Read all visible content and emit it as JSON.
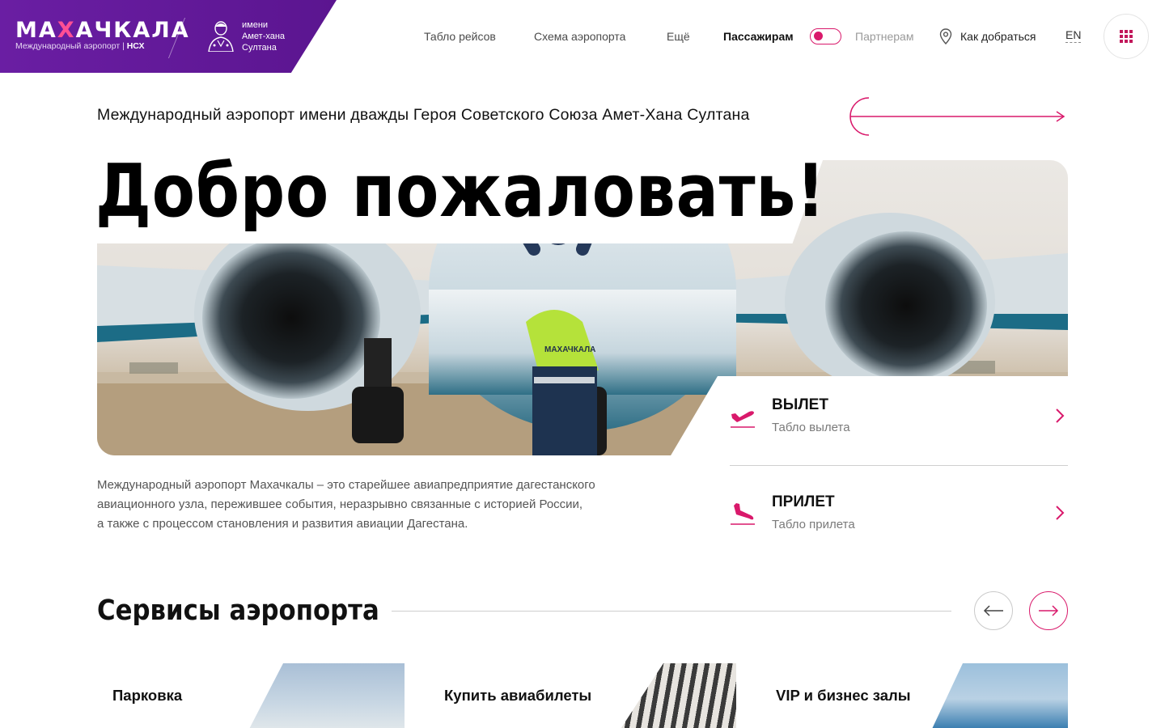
{
  "header": {
    "logo_title": "МАХАЧКАЛА",
    "logo_subtitle": "Международный аэропорт",
    "logo_brand": "НСХ",
    "honor_line1": "имени",
    "honor_line2": "Амет-хана",
    "honor_line3": "Султана",
    "nav": [
      {
        "label": "Табло рейсов"
      },
      {
        "label": "Схема аэропорта"
      },
      {
        "label": "Ещё"
      }
    ],
    "audience_active": "Пассажирам",
    "audience_inactive": "Партнерам",
    "directions": "Как добраться",
    "language": "EN"
  },
  "hero": {
    "subtitle": "Международный аэропорт имени дважды Героя Советского Союза Амет-Хана Султана",
    "title": "Добро пожаловать!",
    "description_lines": [
      "Международный аэропорт Махачкалы – это старейшее авиапредприятие дагестанского",
      "авиационного узла, пережившее события, неразрывно связанные с историей России,",
      "а также с процессом становления и развития авиации Дагестана."
    ],
    "vest_text": "МАХАЧКАЛА"
  },
  "board": {
    "departure": {
      "title": "ВЫЛЕТ",
      "subtitle": "Табло вылета"
    },
    "arrival": {
      "title": "ПРИЛЕТ",
      "subtitle": "Табло прилета"
    }
  },
  "services": {
    "title": "Сервисы аэропорта",
    "cards": [
      {
        "label": "Парковка"
      },
      {
        "label": "Купить авиабилеты"
      },
      {
        "label": "VIP и бизнес залы"
      }
    ]
  },
  "colors": {
    "brand_purple": "#5b1590",
    "accent_pink": "#d9196b"
  }
}
